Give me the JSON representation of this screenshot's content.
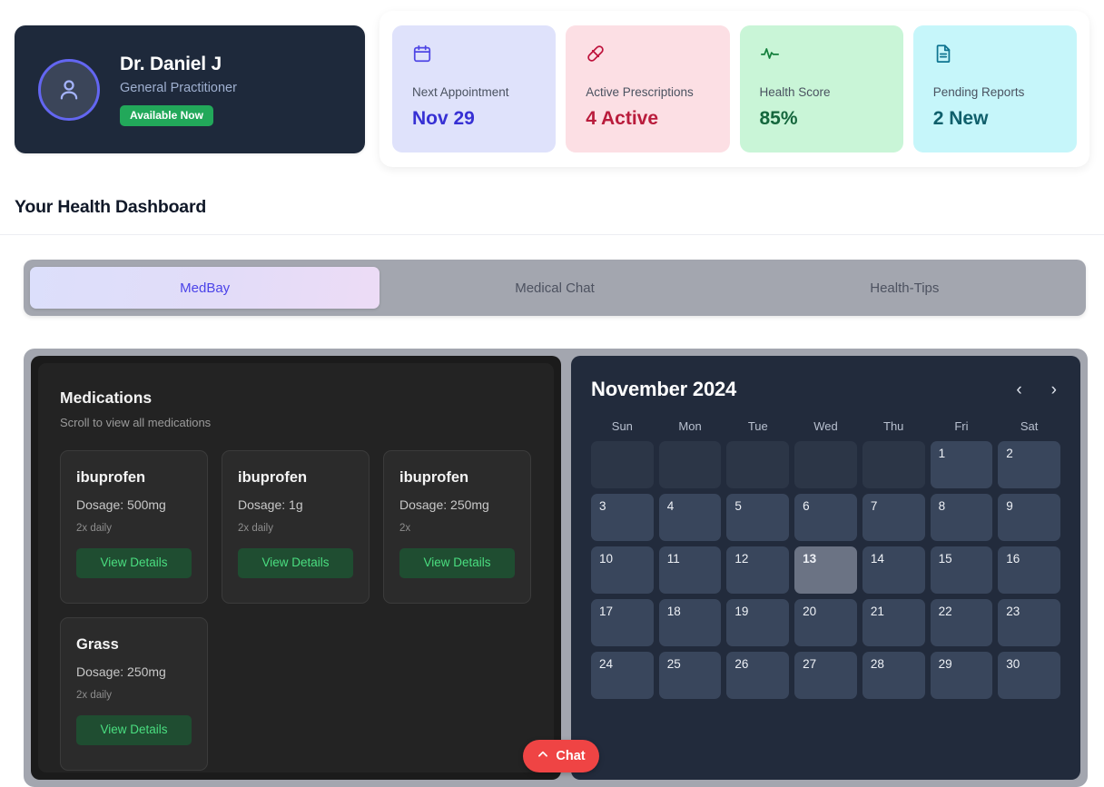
{
  "doctor": {
    "name": "Dr. Daniel J",
    "role": "General Practitioner",
    "status_badge": "Available Now",
    "avatar_icon": "user-icon",
    "ring_color": "#6366f1",
    "badge_color": "#22a85a",
    "card_bg": "#1e293b"
  },
  "stats": [
    {
      "icon": "calendar-icon",
      "label": "Next Appointment",
      "value": "Nov 29",
      "bg": "#dfe2fb",
      "accent": "#3730d4"
    },
    {
      "icon": "pill-icon",
      "label": "Active Prescriptions",
      "value": "4 Active",
      "bg": "#fcdfe4",
      "accent": "#b91c3c"
    },
    {
      "icon": "activity-pulse-icon",
      "label": "Health Score",
      "value": "85%",
      "bg": "#c9f5d7",
      "accent": "#14663c"
    },
    {
      "icon": "document-icon",
      "label": "Pending Reports",
      "value": "2 New",
      "bg": "#c6f6fa",
      "accent": "#0f5f6b"
    }
  ],
  "dashboard": {
    "title": "Your Health Dashboard"
  },
  "tabs": {
    "items": [
      {
        "label": "MedBay",
        "active": true
      },
      {
        "label": "Medical Chat",
        "active": false
      },
      {
        "label": "Health-Tips",
        "active": false
      }
    ],
    "bar_color": "#a3a6af",
    "active_text_color": "#4b43e8"
  },
  "medications": {
    "title": "Medications",
    "subtitle": "Scroll to view all medications",
    "button_label": "View Details",
    "items": [
      {
        "name": "ibuprofen",
        "dosage": "Dosage: 500mg",
        "frequency": "2x daily"
      },
      {
        "name": "ibuprofen",
        "dosage": "Dosage: 1g",
        "frequency": "2x daily"
      },
      {
        "name": "ibuprofen",
        "dosage": "Dosage: 250mg",
        "frequency": "2x"
      },
      {
        "name": "Grass",
        "dosage": "Dosage: 250mg",
        "frequency": "2x daily"
      }
    ]
  },
  "calendar": {
    "month_title": "November 2024",
    "prev_icon": "chevron-left-icon",
    "next_icon": "chevron-right-icon",
    "prev_label": "‹",
    "next_label": "›",
    "weekdays": [
      "Sun",
      "Mon",
      "Tue",
      "Wed",
      "Thu",
      "Fri",
      "Sat"
    ],
    "leading_blanks": 5,
    "days": [
      1,
      2,
      3,
      4,
      5,
      6,
      7,
      8,
      9,
      10,
      11,
      12,
      13,
      14,
      15,
      16,
      17,
      18,
      19,
      20,
      21,
      22,
      23,
      24,
      25,
      26,
      27,
      28,
      29,
      30
    ],
    "today": 13
  },
  "chat": {
    "label": "Chat",
    "icon": "chevron-up-icon",
    "color": "#ef4444"
  }
}
